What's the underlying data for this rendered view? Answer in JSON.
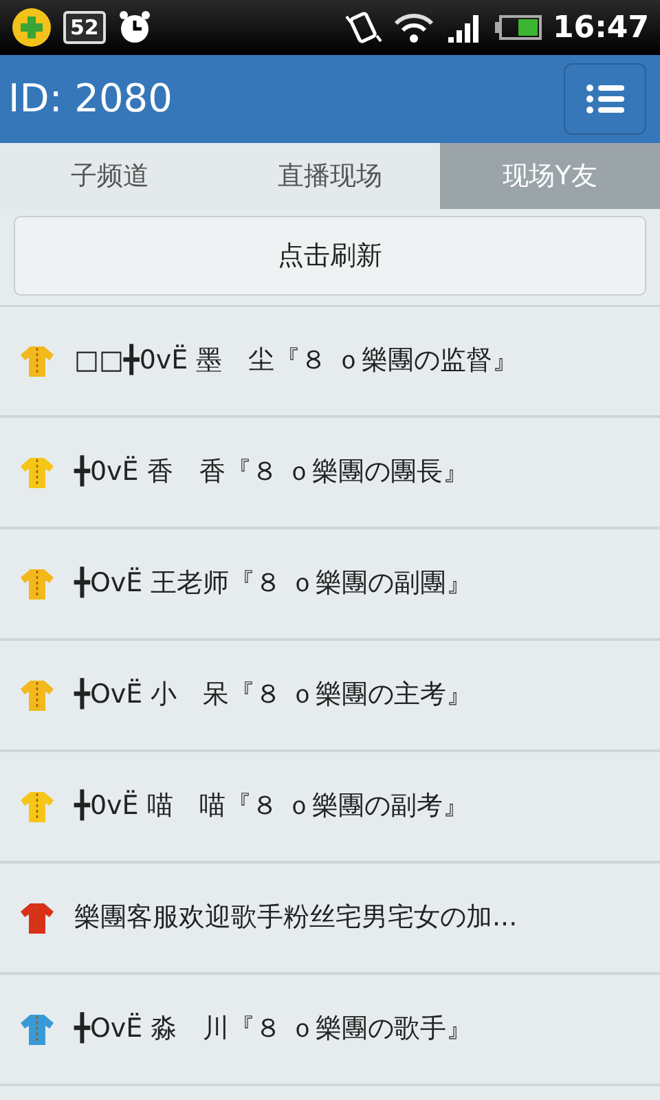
{
  "status_bar": {
    "notification_badge": "52",
    "time": "16:47"
  },
  "header": {
    "title": "ID: 2080"
  },
  "tabs": [
    {
      "label": "子频道",
      "selected": false
    },
    {
      "label": "直播现场",
      "selected": false
    },
    {
      "label": "现场Y友",
      "selected": true
    }
  ],
  "refresh_button": "点击刷新",
  "members": [
    {
      "name": "□□╋0vË 墨　尘『８ ｏ樂團の监督』",
      "color": "#f2b81c"
    },
    {
      "name": "╋0vË 香　香『８ ｏ樂團の團長』",
      "color": "#f5c518"
    },
    {
      "name": "╋OvË 王老师『８ ｏ樂團の副團』",
      "color": "#f2b81c"
    },
    {
      "name": "╋OvË 小　呆『８ ｏ樂團の主考』",
      "color": "#f2b81c"
    },
    {
      "name": "╋0vË 喵　喵『８ ｏ樂團の副考』",
      "color": "#f5c518"
    },
    {
      "name": "樂團客服欢迎歌手粉丝宅男宅女の加...",
      "color": "#d9301a"
    },
    {
      "name": "╋OvË 淼　川『８ ｏ樂團の歌手』",
      "color": "#3a9ad6"
    }
  ]
}
